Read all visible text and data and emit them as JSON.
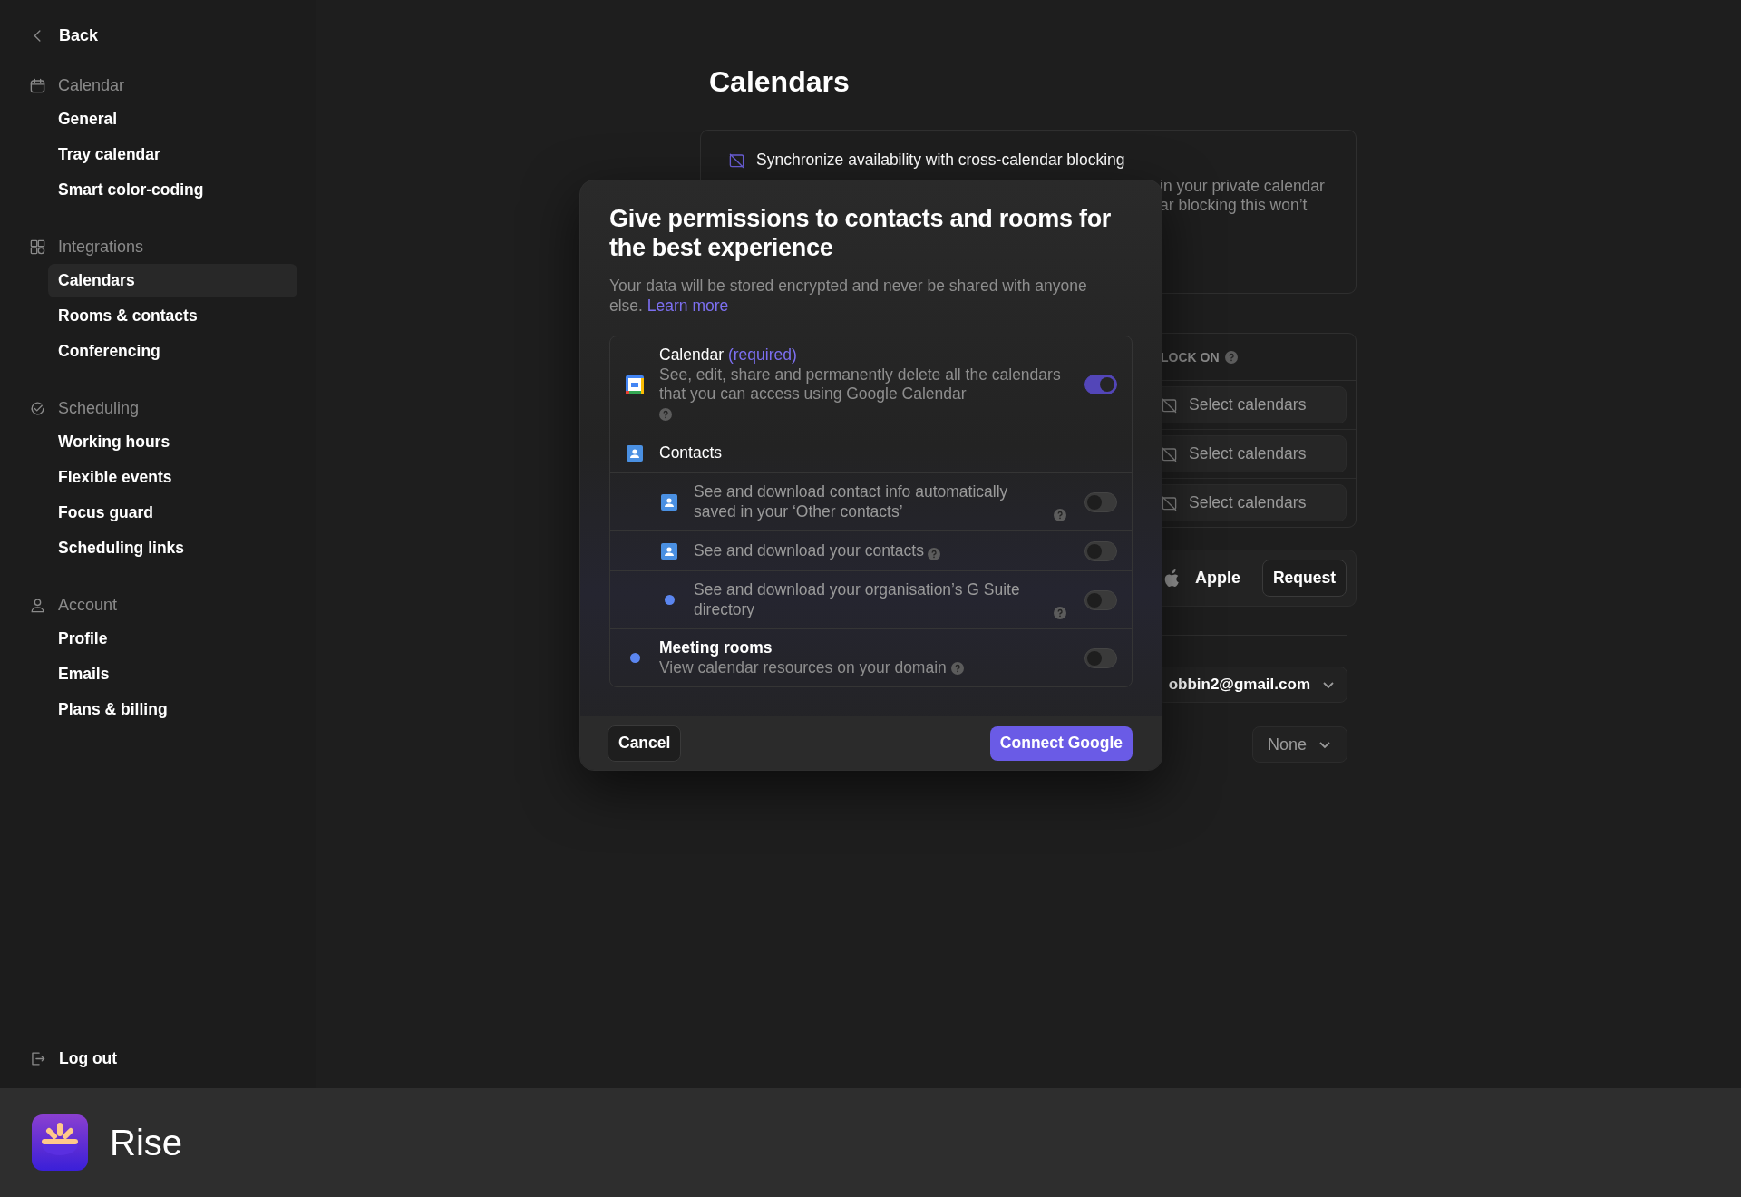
{
  "sidebar": {
    "back": "Back",
    "sections": [
      {
        "title": "Calendar",
        "items": [
          {
            "label": "General",
            "selected": false
          },
          {
            "label": "Tray calendar",
            "selected": false
          },
          {
            "label": "Smart color-coding",
            "selected": false
          }
        ]
      },
      {
        "title": "Integrations",
        "items": [
          {
            "label": "Calendars",
            "selected": true
          },
          {
            "label": "Rooms & contacts",
            "selected": false
          },
          {
            "label": "Conferencing",
            "selected": false
          }
        ]
      },
      {
        "title": "Scheduling",
        "items": [
          {
            "label": "Working hours",
            "selected": false
          },
          {
            "label": "Flexible events",
            "selected": false
          },
          {
            "label": "Focus guard",
            "selected": false
          },
          {
            "label": "Scheduling links",
            "selected": false
          }
        ]
      },
      {
        "title": "Account",
        "items": [
          {
            "label": "Profile",
            "selected": false
          },
          {
            "label": "Emails",
            "selected": false
          },
          {
            "label": "Plans & billing",
            "selected": false
          }
        ]
      }
    ],
    "logout": "Log out"
  },
  "main": {
    "title": "Calendars",
    "sync_card": {
      "title": "Synchronize availability with cross-calendar blocking",
      "text_lines": [
        "in your private calendar",
        "ar blocking this won’t"
      ]
    },
    "block_table": {
      "header": "LOCK ON",
      "rows": [
        "Select calendars",
        "Select calendars",
        "Select calendars"
      ]
    },
    "apple": {
      "label": "Apple",
      "button": "Request"
    },
    "account_select": {
      "value": "obbin2@gmail.com"
    },
    "other_select": {
      "value": "None"
    }
  },
  "modal": {
    "title": "Give permissions to contacts and rooms for the best experience",
    "description": "Your data will be stored encrypted and never be shared with anyone else.",
    "link": "Learn more",
    "permissions": [
      {
        "kind": "calendar",
        "title": "Calendar",
        "badge": "(required)",
        "description": "See, edit, share and permanently delete all the calendars that you can access using Google Calendar",
        "on": true
      },
      {
        "kind": "contacts-header",
        "title": "Contacts"
      },
      {
        "kind": "contacts-sub",
        "description": "See and download contact info automatically saved in your ‘Other contacts’",
        "on": false
      },
      {
        "kind": "contacts-sub",
        "description": "See and download your contacts",
        "on": false
      },
      {
        "kind": "dot-sub",
        "description": "See and download your organisation’s G Suite directory",
        "on": false
      },
      {
        "kind": "rooms",
        "title": "Meeting rooms",
        "description": "View calendar resources on your domain",
        "on": false
      }
    ],
    "cancel": "Cancel",
    "confirm": "Connect Google"
  },
  "brand": {
    "name": "Rise"
  }
}
